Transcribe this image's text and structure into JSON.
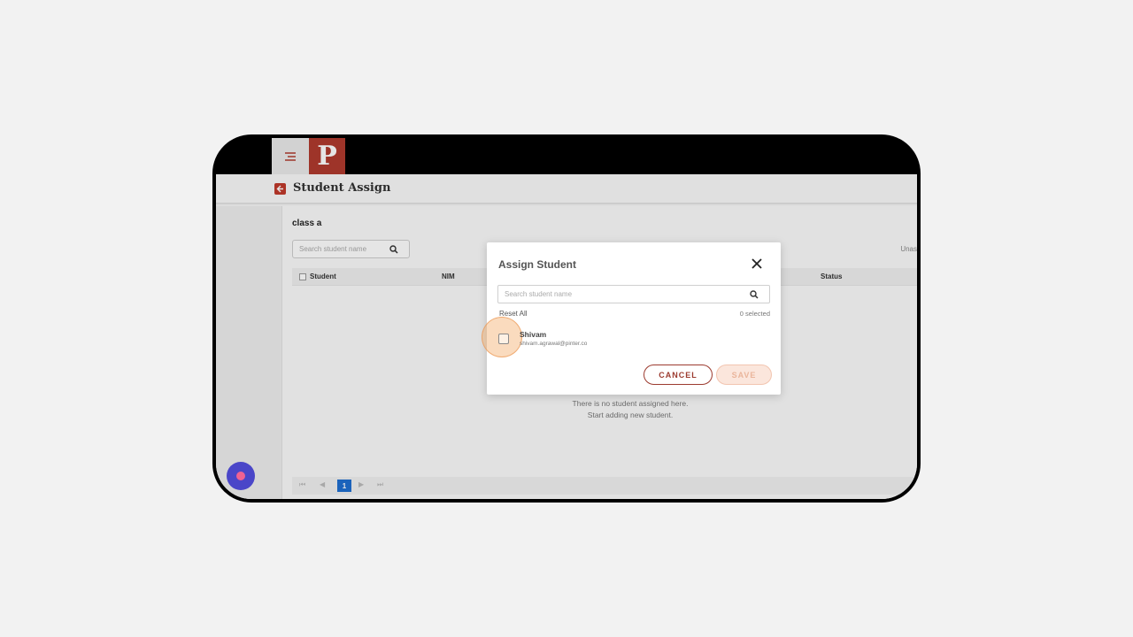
{
  "header": {
    "logo_letter": "P",
    "page_title": "Student Assign"
  },
  "content": {
    "class_name": "class a",
    "search_placeholder": "Search student name",
    "unassign_label": "Unas",
    "table_headers": [
      "Student",
      "NIM",
      "Status"
    ],
    "empty_line1": "There is no student assigned here.",
    "empty_line2": "Start adding new student.",
    "pagination": {
      "first": "⏮",
      "prev": "◀",
      "current_page": "1",
      "next": "▶",
      "last": "⏭"
    }
  },
  "modal": {
    "title": "Assign Student",
    "search_placeholder": "Search student name",
    "reset_all": "Reset All",
    "selected_count": "0 selected",
    "students": [
      {
        "name": "Shivam",
        "email": "shivam.agrawal@pinter.co",
        "checked": false
      }
    ],
    "cancel_label": "CANCEL",
    "save_label": "SAVE"
  },
  "colors": {
    "brand": "#b03a2e",
    "cancel_border": "#9c3b2f",
    "save_disabled_bg": "#fbe6dc",
    "pager_active": "#1f6fd1",
    "fab": "#4a46c8",
    "focus_ring": "#f5af6e"
  },
  "icons": {
    "menu": "menu-icon",
    "back": "back-arrow-icon",
    "search": "search-icon",
    "close": "close-icon",
    "fab": "record-icon"
  }
}
